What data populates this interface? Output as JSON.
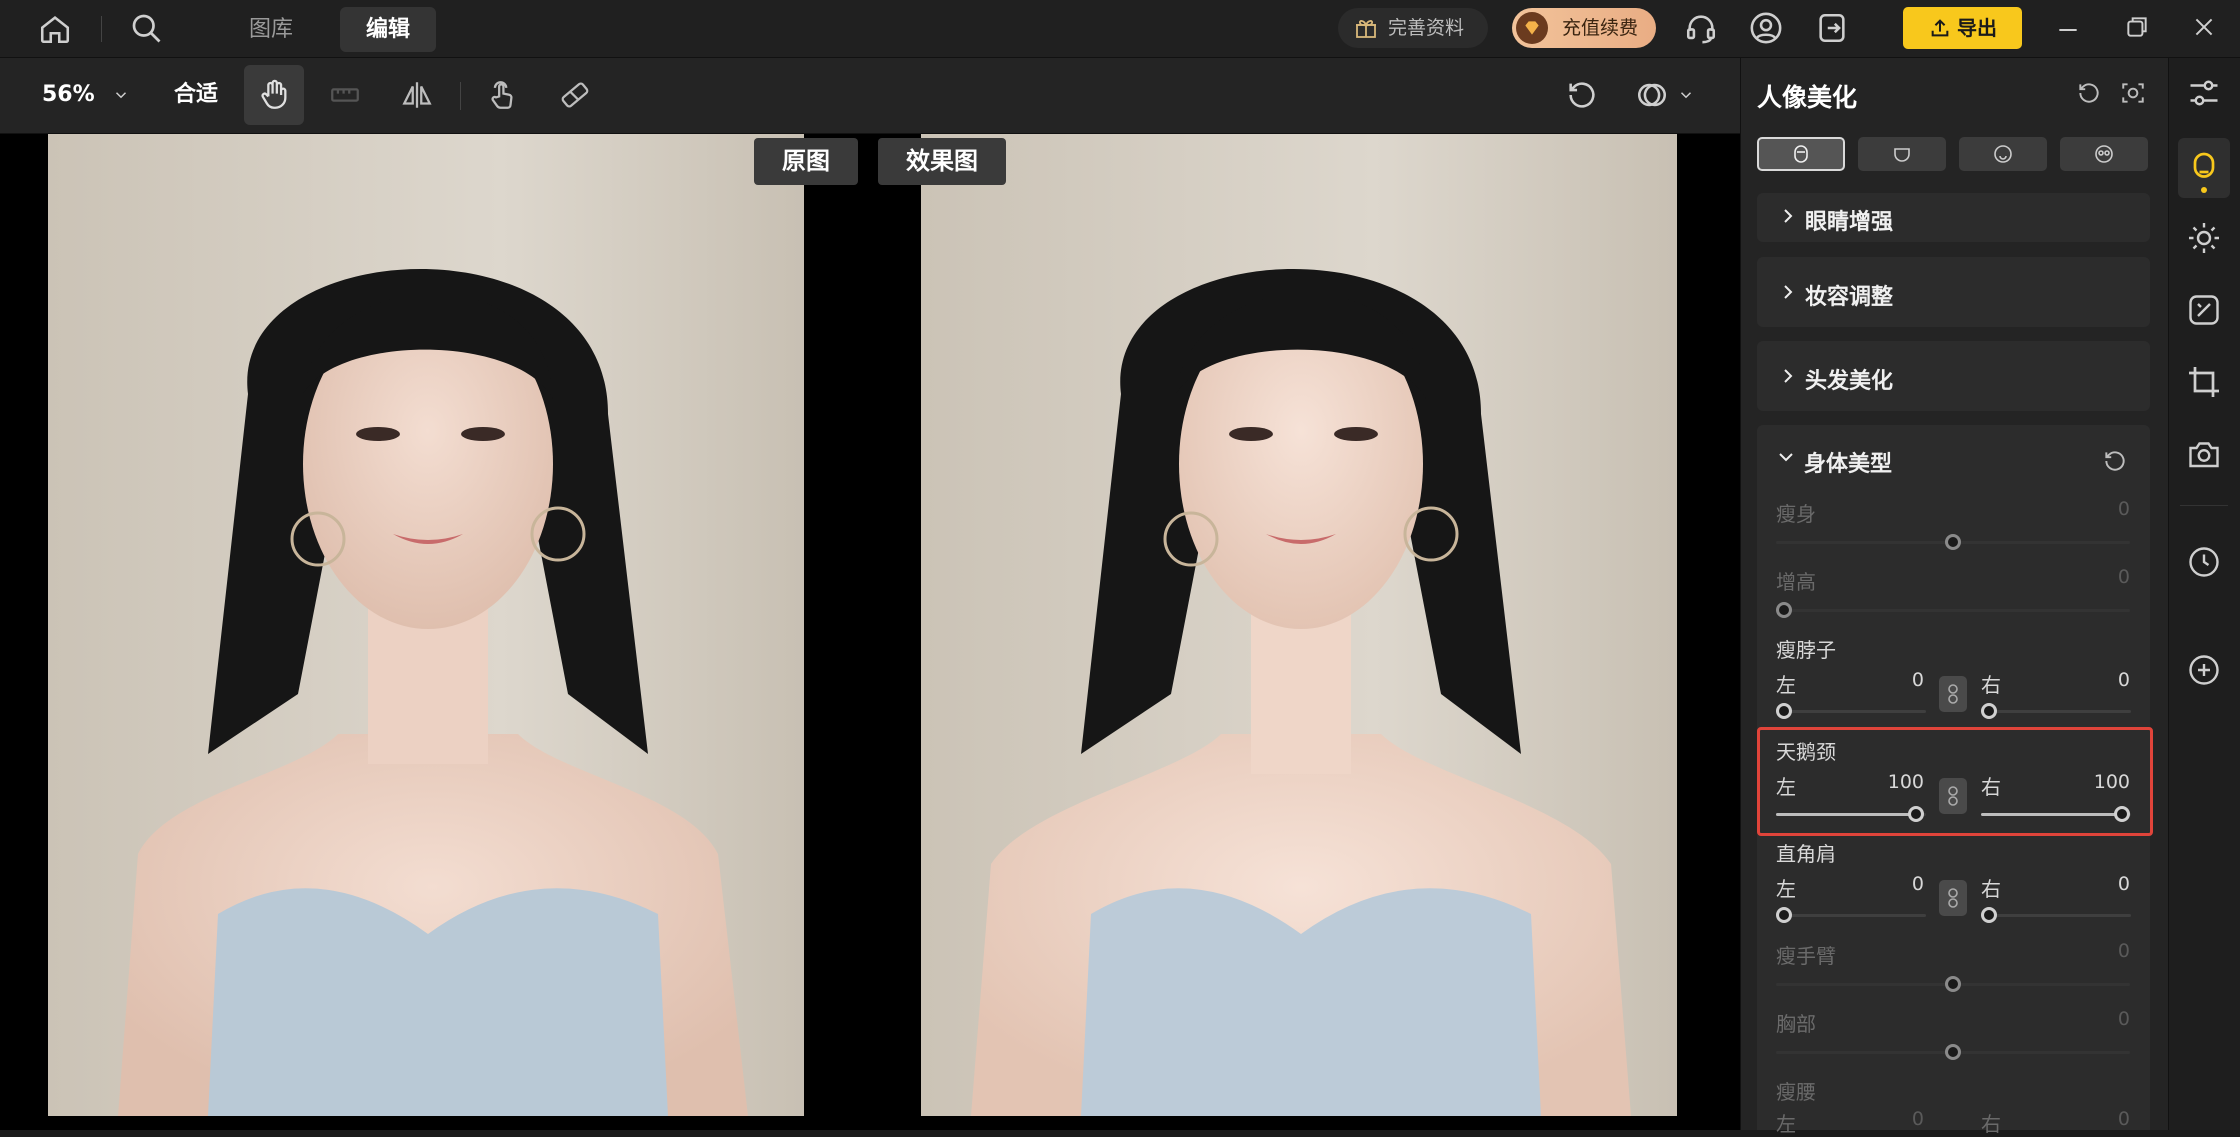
{
  "topbar": {
    "tabs": [
      {
        "label": "图库"
      },
      {
        "label": "编辑"
      }
    ],
    "profile_btn": "完善资料",
    "recharge_btn": "充值续费",
    "export_btn": "导出"
  },
  "toolbar": {
    "zoom": "56%",
    "fit_label": "合适"
  },
  "canvas": {
    "original_label": "原图",
    "result_label": "效果图"
  },
  "panel": {
    "title": "人像美化",
    "collapsed_sections": [
      "眼睛增强",
      "妆容调整",
      "头发美化"
    ],
    "body_section": {
      "title": "身体美型",
      "left_label": "左",
      "right_label": "右",
      "sliders": {
        "slim_body": {
          "label": "瘦身",
          "value": "0",
          "level": 0.5,
          "enabled": false
        },
        "heighten": {
          "label": "增高",
          "value": "0",
          "level": 0.0,
          "enabled": false
        },
        "slim_neck": {
          "label": "瘦脖子",
          "left": "0",
          "right": "0",
          "left_level": 0,
          "right_level": 0
        },
        "swan_neck": {
          "label": "天鹅颈",
          "left": "100",
          "right": "100",
          "left_level": 1,
          "right_level": 1
        },
        "square_shoulder": {
          "label": "直角肩",
          "left": "0",
          "right": "0",
          "left_level": 0,
          "right_level": 0
        },
        "slim_arm": {
          "label": "瘦手臂",
          "value": "0",
          "level": 0.5,
          "enabled": false
        },
        "chest": {
          "label": "胸部",
          "value": "0",
          "level": 0.5,
          "enabled": false
        },
        "slim_waist": {
          "label": "瘦腰",
          "left": "0",
          "right": "0"
        }
      }
    }
  },
  "colors": {
    "accent": "#f8c81c",
    "highlight": "#e0443a",
    "recharge": "#f5c9a0"
  }
}
